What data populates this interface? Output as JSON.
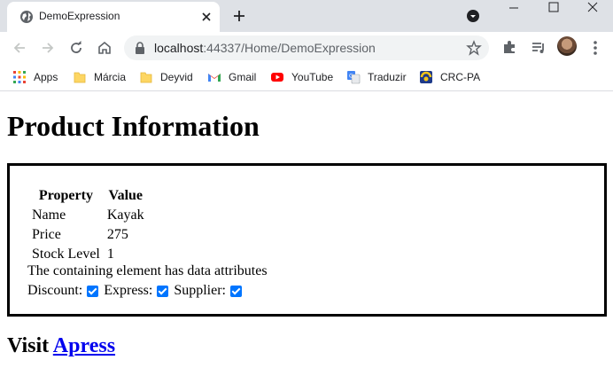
{
  "browser": {
    "tab": {
      "title": "DemoExpression"
    },
    "address": {
      "host": "localhost",
      "rest": ":44337/Home/DemoExpression"
    },
    "bookmarks": [
      {
        "label": "Apps",
        "icon": "apps-grid-icon"
      },
      {
        "label": "Márcia",
        "icon": "folder-icon"
      },
      {
        "label": "Deyvid",
        "icon": "folder-icon"
      },
      {
        "label": "Gmail",
        "icon": "gmail-icon"
      },
      {
        "label": "YouTube",
        "icon": "youtube-icon"
      },
      {
        "label": "Traduzir",
        "icon": "translate-icon"
      },
      {
        "label": "CRC-PA",
        "icon": "crc-icon"
      }
    ]
  },
  "page": {
    "heading": "Product Information",
    "table": {
      "headers": [
        "Property",
        "Value"
      ],
      "rows": [
        [
          "Name",
          "Kayak"
        ],
        [
          "Price",
          "275"
        ],
        [
          "Stock Level",
          "1"
        ]
      ]
    },
    "note": "The containing element has data attributes",
    "flags": [
      {
        "label": "Discount:",
        "checked": true
      },
      {
        "label": "Express:",
        "checked": true
      },
      {
        "label": "Supplier:",
        "checked": true
      }
    ],
    "visit": {
      "prefix": "Visit",
      "link": "Apress"
    }
  },
  "colors": {
    "link": "#0000ee",
    "checkbox": "#0075ff",
    "tabstrip": "#dee1e6"
  }
}
